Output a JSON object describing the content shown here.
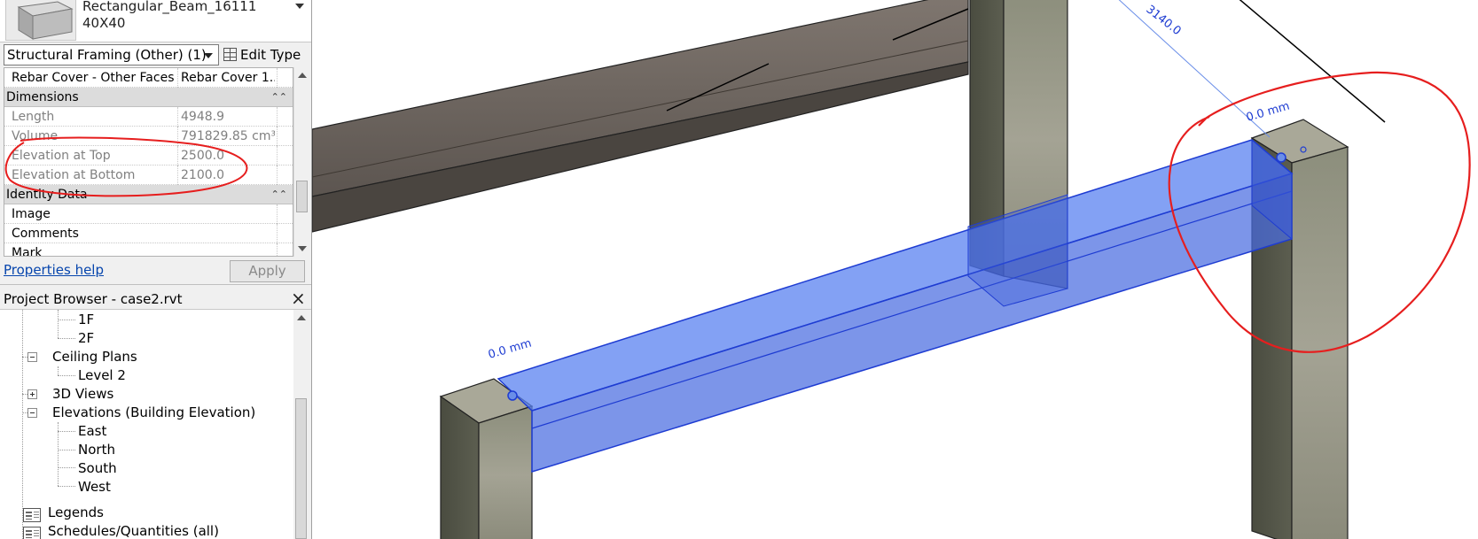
{
  "properties": {
    "type_name": "Rectangular_Beam_16111",
    "type_size": "40X40",
    "filter_label": "Structural Framing (Other) (1)",
    "edit_type_label": "Edit Type",
    "rows": [
      {
        "kind": "param",
        "name": "Rebar Cover - Other Faces",
        "value": "Rebar Cover 1...",
        "readonly": false
      },
      {
        "kind": "group",
        "name": "Dimensions"
      },
      {
        "kind": "param",
        "name": "Length",
        "value": "4948.9",
        "readonly": true
      },
      {
        "kind": "param",
        "name": "Volume",
        "value": "791829.85 cm³",
        "readonly": true
      },
      {
        "kind": "param",
        "name": "Elevation at Top",
        "value": "2500.0",
        "readonly": true
      },
      {
        "kind": "param",
        "name": "Elevation at Bottom",
        "value": "2100.0",
        "readonly": true
      },
      {
        "kind": "group",
        "name": "Identity Data"
      },
      {
        "kind": "param",
        "name": "Image",
        "value": "",
        "readonly": false
      },
      {
        "kind": "param",
        "name": "Comments",
        "value": "",
        "readonly": false
      },
      {
        "kind": "param",
        "name": "Mark",
        "value": "",
        "readonly": false
      }
    ],
    "help_link": "Properties help",
    "apply_label": "Apply"
  },
  "project_browser": {
    "title": "Project Browser - case2.rvt",
    "close_icon": "×",
    "nodes": [
      {
        "label": "1F"
      },
      {
        "label": "2F"
      },
      {
        "label": "Ceiling Plans"
      },
      {
        "label": "Level 2"
      },
      {
        "label": "3D Views"
      },
      {
        "label": "Elevations (Building Elevation)"
      },
      {
        "label": "East"
      },
      {
        "label": "North"
      },
      {
        "label": "South"
      },
      {
        "label": "West"
      },
      {
        "label": "Legends"
      },
      {
        "label": "Schedules/Quantities (all)"
      }
    ]
  },
  "viewport": {
    "dim_left": "0.0 mm",
    "dim_right": "0.0 mm",
    "dim_length": "3140.0",
    "colors": {
      "selection_fill": "#5a82f0",
      "selection_edge": "#1e3cd2",
      "annotation": "#e61e1e",
      "concrete": "#9a9a8c",
      "beam_top": "#6d6660"
    }
  }
}
